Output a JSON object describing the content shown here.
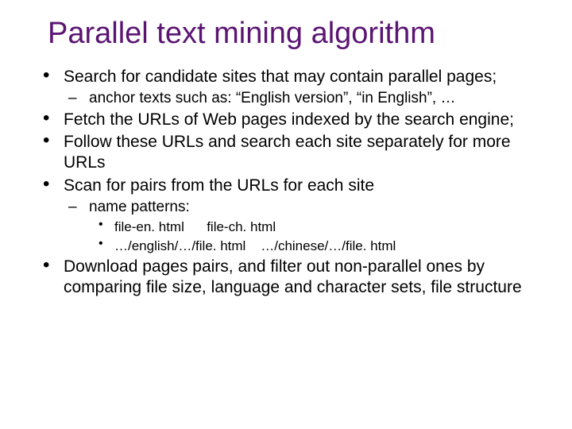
{
  "title": "Parallel text mining algorithm",
  "bullets": {
    "b0": "Search for candidate sites that may contain parallel pages;",
    "b0s0": "anchor texts such as: “English version”, “in English”, …",
    "b1": "Fetch the URLs of Web pages indexed by the search engine;",
    "b2": "Follow these URLs and search each site separately for more URLs",
    "b3": "Scan for pairs from the URLs for each site",
    "b3s0": "name patterns:",
    "b3s0a": "file-en. html      file-ch. html",
    "b3s0b": "…/english/…/file. html    …/chinese/…/file. html",
    "b4": "Download pages pairs, and filter out non-parallel ones by comparing file size, language and character sets, file structure"
  }
}
